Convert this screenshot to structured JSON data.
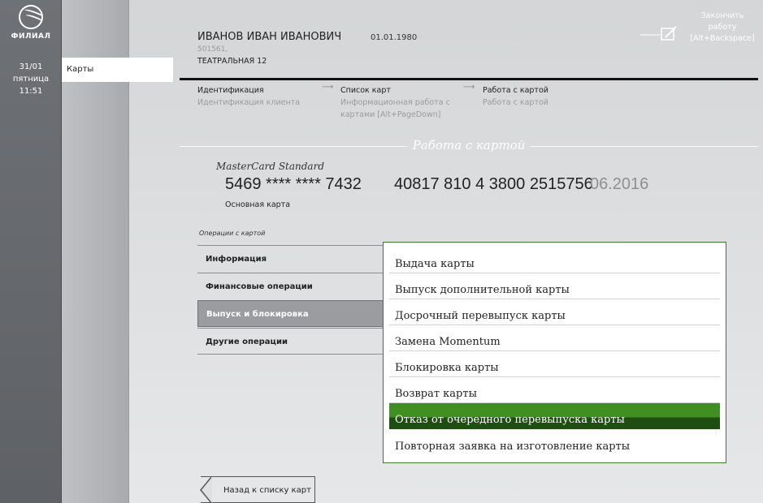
{
  "sidebar": {
    "logo_text": "ФИЛИАЛ",
    "date": "31/01",
    "weekday": "пятница",
    "time": "11:51",
    "nav_active": "Карты"
  },
  "client": {
    "name": "ИВАНОВ ИВАН ИВАНОВИЧ",
    "dob": "01.01.1980",
    "code": "501561,",
    "address": "ТЕАТРАЛЬНАЯ 12"
  },
  "header": {
    "logout_line1": "Закончить",
    "logout_line2": "работу",
    "logout_hotkey": "[Alt+Backspace]"
  },
  "breadcrumb": [
    {
      "title": "Идентификация",
      "sub": "Идентификация клиента"
    },
    {
      "title": "Список карт",
      "sub": "Информационная работа с картами [Alt+PageDown]"
    },
    {
      "title": "Работа с картой",
      "sub": "Работа с картой"
    }
  ],
  "section_title": "Работа с картой",
  "card": {
    "type": "MasterCard Standard",
    "number": "5469 **** **** 7432",
    "account": "40817 810 4 3800 2515756",
    "expiry": "06.2016",
    "label": "Основная карта"
  },
  "operations": {
    "heading": "Операции с картой",
    "items": [
      "Информация",
      "Финансовые операции",
      "Выпуск и блокировка",
      "Другие операции"
    ],
    "active_index": 2
  },
  "submenu": {
    "items": [
      "Выдача карты",
      "Выпуск дополнительной карты",
      "Досрочный перевыпуск карты",
      "Замена Momentum",
      "Блокировка карты",
      "Возврат карты",
      "Отказ от очередного перевыпуска карты",
      "Повторная заявка на изготовление карты"
    ],
    "selected_index": 6
  },
  "back_button": "Назад к списку карт",
  "colors": {
    "accent_green": "#3f8f22",
    "accent_green_dark": "#1f4e12",
    "rail": "#6e7175"
  }
}
